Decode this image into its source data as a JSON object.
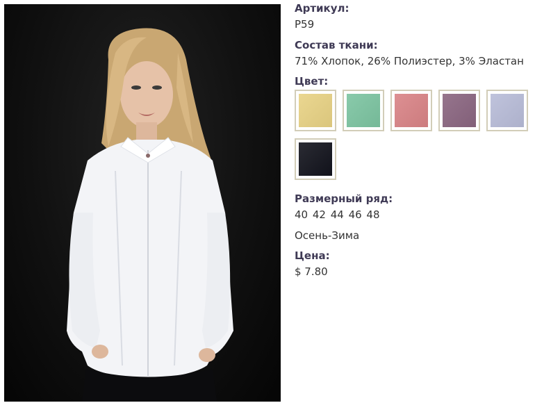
{
  "product": {
    "sku_label": "Артикул:",
    "sku_value": "P59",
    "fabric_label": "Состав ткани:",
    "fabric_value": "71% Хлопок, 26% Полиэстер, 3% Эластан",
    "color_label": "Цвет:",
    "colors": [
      {
        "name": "yellow",
        "hex": "#e8d284"
      },
      {
        "name": "mint",
        "hex": "#7cc4a1"
      },
      {
        "name": "pink",
        "hex": "#d98386"
      },
      {
        "name": "plum",
        "hex": "#8a6580"
      },
      {
        "name": "lavender",
        "hex": "#b8bcd8"
      },
      {
        "name": "black",
        "hex": "#12131c"
      }
    ],
    "size_label": "Размерный ряд:",
    "size_value": "40 42 44 46 48",
    "season": "Осень-Зима",
    "price_label": "Цена:",
    "price_value": "$ 7.80"
  },
  "image": {
    "subject": "model-in-white-shirt"
  },
  "colors": {
    "label_text": "#3f3a55",
    "body_text": "#333333",
    "swatch_border": "#d2cdb8",
    "photo_background": "#111111"
  }
}
